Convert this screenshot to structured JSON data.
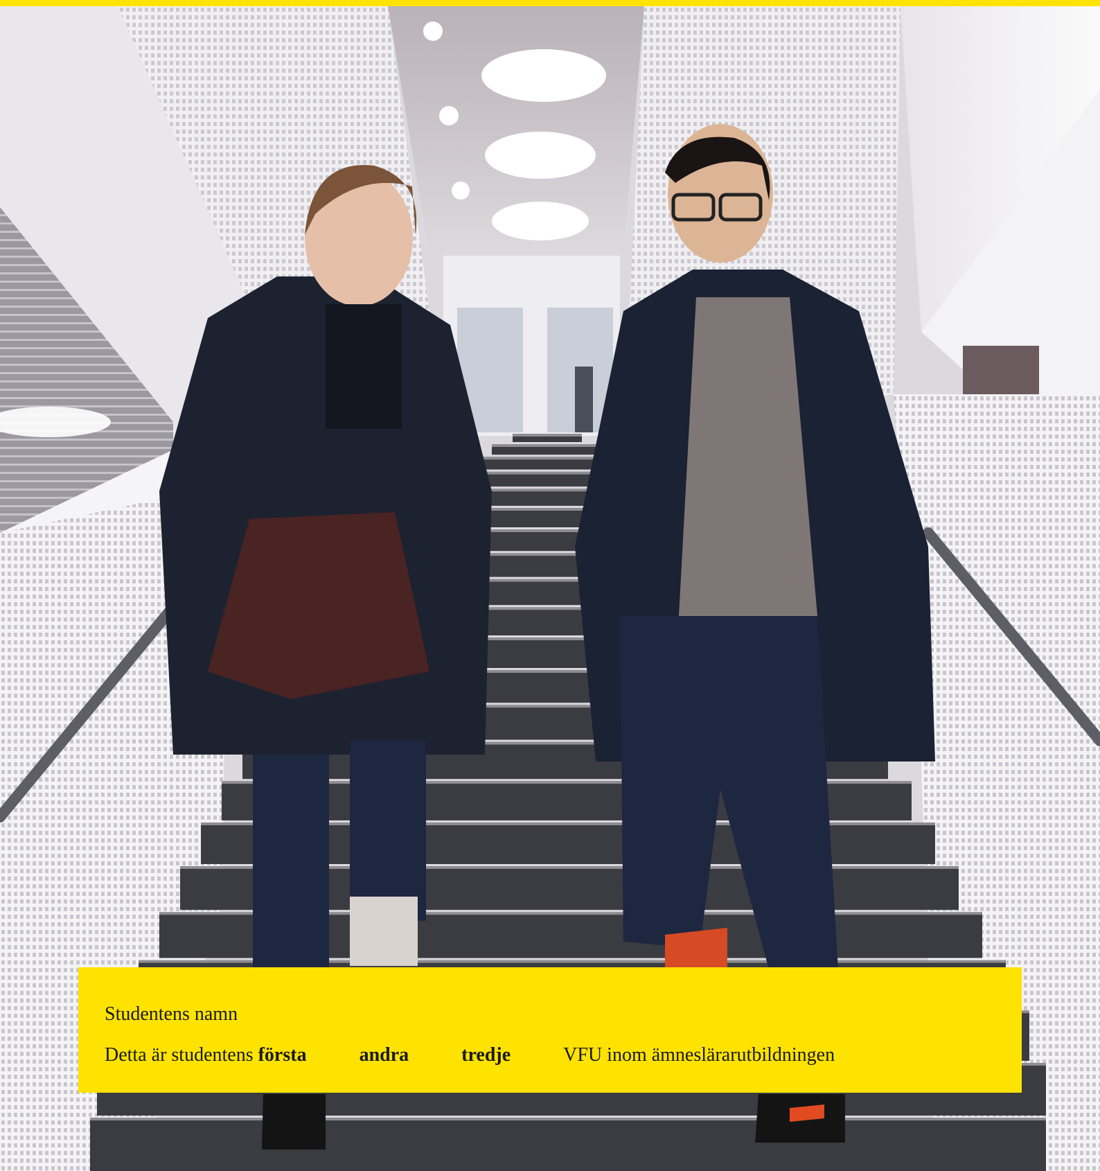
{
  "document": {
    "brand_color": "#ffe300",
    "student_name_label": "Studentens namn",
    "visit_prefix": "Detta är studentens",
    "visit_options": [
      "första",
      "andra",
      "tredje"
    ],
    "visit_suffix": "VFU inom ämneslärarutbildningen"
  }
}
